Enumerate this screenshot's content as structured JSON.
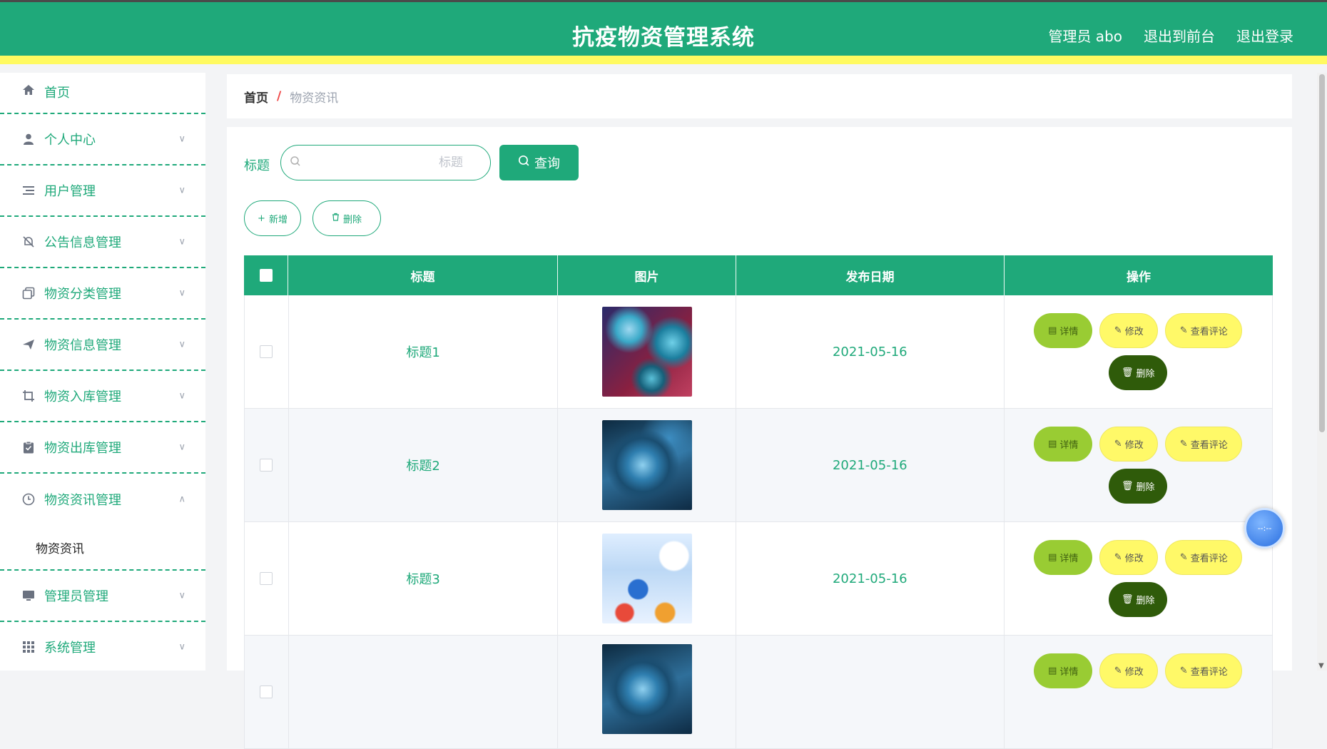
{
  "header": {
    "title": "抗疫物资管理系统",
    "admin": "管理员 abo",
    "to_front": "退出到前台",
    "logout": "退出登录"
  },
  "sidebar": {
    "items": [
      {
        "label": "首页",
        "icon": "home-icon"
      },
      {
        "label": "个人中心",
        "icon": "user-icon"
      },
      {
        "label": "用户管理",
        "icon": "list-icon"
      },
      {
        "label": "公告信息管理",
        "icon": "bell-off-icon"
      },
      {
        "label": "物资分类管理",
        "icon": "copy-icon"
      },
      {
        "label": "物资信息管理",
        "icon": "send-icon"
      },
      {
        "label": "物资入库管理",
        "icon": "crop-icon"
      },
      {
        "label": "物资出库管理",
        "icon": "clipboard-icon"
      },
      {
        "label": "物资资讯管理",
        "icon": "clock-icon"
      },
      {
        "label": "管理员管理",
        "icon": "monitor-icon"
      },
      {
        "label": "系统管理",
        "icon": "grid-icon"
      }
    ],
    "submenu_active": "物资资讯"
  },
  "breadcrumb": {
    "home": "首页",
    "separator": "/",
    "current": "物资资讯"
  },
  "search": {
    "label": "标题",
    "placeholder": "标题",
    "query_button": "查询"
  },
  "actions": {
    "add": "新增",
    "delete": "删除"
  },
  "table": {
    "columns": [
      "标题",
      "图片",
      "发布日期",
      "操作"
    ],
    "rows": [
      {
        "title": "标题1",
        "date": "2021-05-16"
      },
      {
        "title": "标题2",
        "date": "2021-05-16"
      },
      {
        "title": "标题3",
        "date": "2021-05-16"
      },
      {
        "title": "",
        "date": ""
      }
    ],
    "op_labels": {
      "detail": "详情",
      "edit": "修改",
      "comments": "查看评论",
      "delete": "删除"
    }
  },
  "float_ball_text": "--:--",
  "colors": {
    "primary": "#1fa97a",
    "accent_yellow": "#fffa60",
    "detail_green": "#99cc33",
    "delete_dark": "#2f5b0a"
  }
}
